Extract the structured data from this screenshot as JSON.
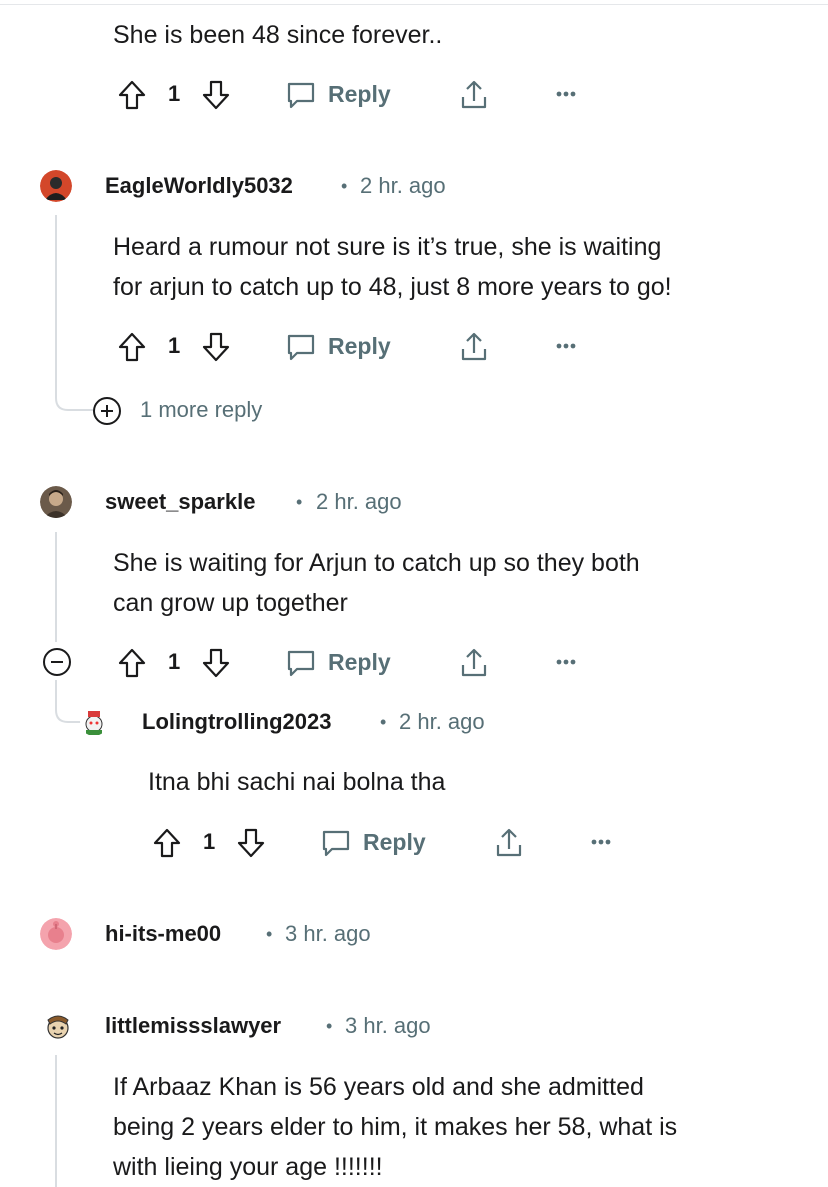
{
  "comments": [
    {
      "body": "She is been 48 since forever..",
      "votes": "1",
      "reply_label": "Reply"
    },
    {
      "username": "EagleWorldly5032",
      "time": "2 hr. ago",
      "body_lines": [
        "Heard a rumour not sure is it’s true, she is waiting",
        "for arjun to catch up to 48, just 8 more years to go!"
      ],
      "votes": "1",
      "reply_label": "Reply",
      "more_replies": "1 more reply"
    },
    {
      "username": "sweet_sparkle",
      "time": "2 hr. ago",
      "body_lines": [
        "She is waiting for Arjun to catch up so they both",
        "can grow up together"
      ],
      "votes": "1",
      "reply_label": "Reply"
    },
    {
      "username": "Lolingtrolling2023",
      "time": "2 hr. ago",
      "body": "Itna bhi sachi nai bolna tha",
      "votes": "1",
      "reply_label": "Reply"
    },
    {
      "username": "hi-its-me00",
      "time": "3 hr. ago"
    },
    {
      "username": "littlemissslawyer",
      "time": "3 hr. ago",
      "body_lines": [
        "If Arbaaz Khan is 56 years old and she admitted",
        "being 2 years elder to him, it makes her 58, what is",
        "with lieing your age !!!!!!!"
      ]
    }
  ],
  "icons": {
    "upvote": "upvote-arrow-icon",
    "downvote": "downvote-arrow-icon",
    "reply": "speech-bubble-icon",
    "share": "share-upload-icon",
    "more": "ellipsis-icon",
    "expand": "plus-circle-icon",
    "collapse": "minus-circle-icon"
  },
  "colors": {
    "text": "#1a1a1b",
    "meta": "#576f76",
    "thread_line": "#d9dde1"
  }
}
